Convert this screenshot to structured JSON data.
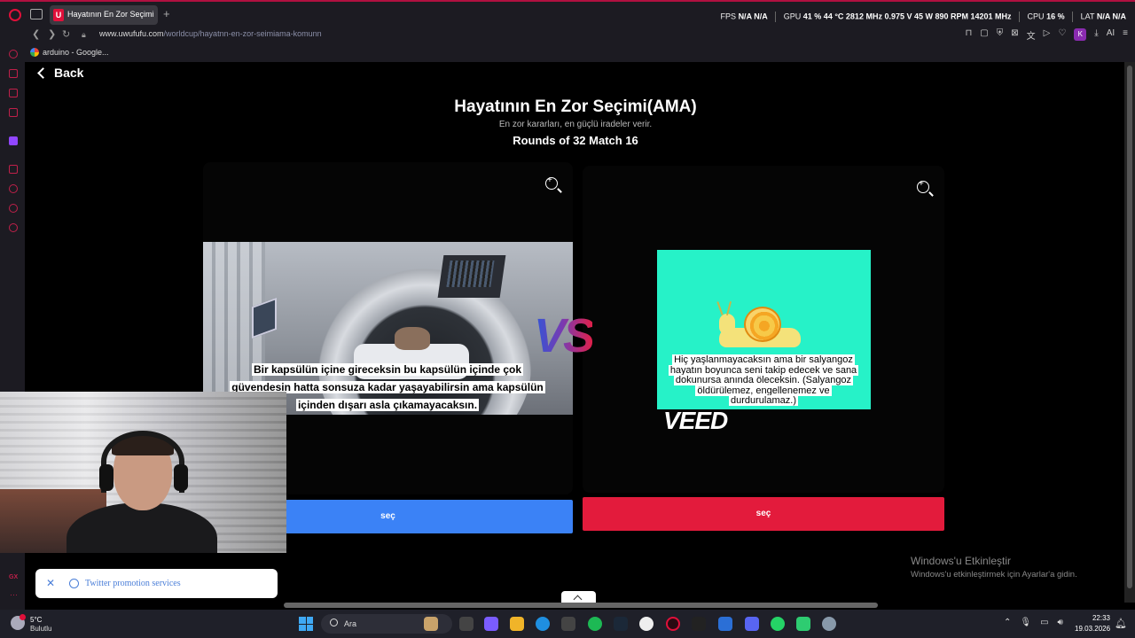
{
  "browser": {
    "tab_title": "Hayatının En Zor Seçimi(AMA)",
    "tab_favicon": "U",
    "url_domain": "www.uwufufu.com",
    "url_path": "/worldcup/hayatnn-en-zor-seimiama-komunn",
    "bookmark_label": "arduino - Google...",
    "k_badge": "K",
    "ai_label": "AI"
  },
  "stats": {
    "fps_label": "FPS",
    "fps_value": "N/A  N/A",
    "gpu_label": "GPU",
    "gpu_values": "41 %  44 °C  2812 MHz  0.975 V  45 W  890 RPM  14201 MHz",
    "cpu_label": "CPU",
    "cpu_value": "16 %",
    "lat_label": "LAT",
    "lat_value": "N/A  N/A"
  },
  "page": {
    "back_label": "Back",
    "title": "Hayatının En Zor Seçimi(AMA)",
    "subtitle": "En zor kararları, en güçlü iradeler verir.",
    "rounds": "Rounds of 32 Match 16",
    "vs_label": "VS",
    "left_caption": "Bir kapsülün içine gireceksin bu kapsülün içinde çok güvendesin hatta sonsuza kadar yaşayabilirsin ama kapsülün içinden dışarı asla çıkamayacaksın.",
    "right_caption": "Hiç yaşlanmayacaksın ama bir salyangoz hayatın boyunca seni takip edecek ve sana dokunursa anında öleceksin. (Salyangoz öldürülemez, engellenemez ve durdurulamaz.)",
    "watermark": "VEED",
    "left_button": "seç",
    "right_button": "seç"
  },
  "toast": {
    "text": "Twitter promotion services"
  },
  "windows_activation": {
    "title": "Windows'u Etkinleştir",
    "subtitle": "Windows'u etkinleştirmek için Ayarlar'a gidin."
  },
  "taskbar": {
    "temperature": "5°C",
    "weather": "Bulutlu",
    "search_placeholder": "Ara",
    "time": "22:33",
    "date": "19.03.2026"
  },
  "sidebar": {
    "gx_label": "GX",
    "more_label": "···"
  },
  "colors": {
    "select_left": "#3b82f6",
    "select_right": "#e31b3c",
    "snail_bg": "#26f2c8",
    "opera_accent": "#e0103a"
  }
}
